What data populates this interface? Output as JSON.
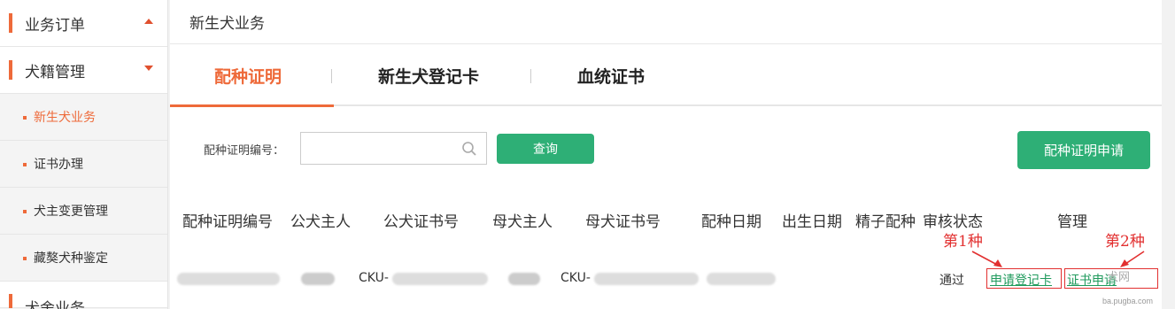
{
  "sidebar": {
    "groups": [
      {
        "label": "业务订单",
        "expanded": true
      },
      {
        "label": "犬籍管理",
        "expanded": false
      },
      {
        "label": "犬舍业务"
      }
    ],
    "sub_items": [
      {
        "label": "新生犬业务",
        "active": true
      },
      {
        "label": "证书办理"
      },
      {
        "label": "犬主变更管理"
      },
      {
        "label": "藏獒犬种鉴定"
      }
    ]
  },
  "header": {
    "title": "新生犬业务"
  },
  "tabs": [
    {
      "label": "配种证明",
      "active": true
    },
    {
      "label": "新生犬登记卡"
    },
    {
      "label": "血统证书"
    }
  ],
  "search": {
    "label": "配种证明编号：",
    "value": "",
    "placeholder": "",
    "query_button": "查询",
    "apply_button": "配种证明申请"
  },
  "table": {
    "columns": [
      "配种证明编号",
      "公犬主人",
      "公犬证书号",
      "母犬主人",
      "母犬证书号",
      "配种日期",
      "出生日期",
      "精子配种",
      "审核状态",
      "管理"
    ],
    "rows": [
      {
        "male_cert": "CKU-",
        "female_cert": "CKU-",
        "status": "通过",
        "actions": [
          "申请登记卡",
          "证书申请"
        ]
      }
    ]
  },
  "annotations": {
    "first": "第1种",
    "second": "第2种"
  },
  "watermark": {
    "logo": "犬网",
    "url": "ba.pugba.com"
  },
  "colors": {
    "accent": "#ee6a3a",
    "green": "#2eaf76",
    "annotation_red": "#e23030"
  }
}
